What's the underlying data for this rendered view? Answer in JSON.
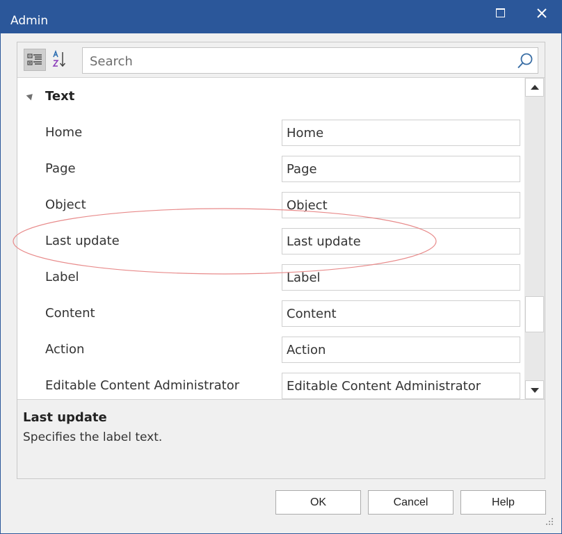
{
  "window": {
    "title": "Admin"
  },
  "toolbar": {
    "categorized_icon": "categorized-view-icon",
    "alphabetical_icon": "sort-az-icon"
  },
  "search": {
    "placeholder": "Search",
    "value": "",
    "icon": "search-icon"
  },
  "grid": {
    "category": "Text",
    "properties": [
      {
        "name": "Home",
        "value": "Home"
      },
      {
        "name": "Page",
        "value": "Page"
      },
      {
        "name": "Object",
        "value": "Object"
      },
      {
        "name": "Last update",
        "value": "Last update"
      },
      {
        "name": "Label",
        "value": "Label"
      },
      {
        "name": "Content",
        "value": "Content"
      },
      {
        "name": "Action",
        "value": "Action"
      },
      {
        "name": "Editable Content Administrator",
        "value": "Editable Content Administrator"
      }
    ]
  },
  "description": {
    "title": "Last update",
    "text": "Specifies the label text."
  },
  "buttons": {
    "ok": "OK",
    "cancel": "Cancel",
    "help": "Help"
  },
  "colors": {
    "titlebar": "#2b579a",
    "highlight": "#e88a8a"
  }
}
